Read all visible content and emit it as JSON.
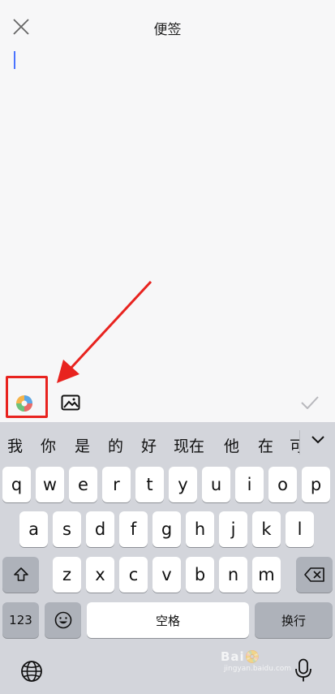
{
  "header": {
    "title": "便签"
  },
  "candidates": [
    "我",
    "你",
    "是",
    "的",
    "好",
    "现在",
    "他",
    "在",
    "可"
  ],
  "keyboard": {
    "row1": [
      "q",
      "w",
      "e",
      "r",
      "t",
      "y",
      "u",
      "i",
      "o",
      "p"
    ],
    "row2": [
      "a",
      "s",
      "d",
      "f",
      "g",
      "h",
      "j",
      "k",
      "l"
    ],
    "row3": [
      "z",
      "x",
      "c",
      "v",
      "b",
      "n",
      "m"
    ],
    "numbers_label": "123",
    "space_label": "空格",
    "return_label": "换行"
  },
  "watermark": {
    "brand": "Bai📀",
    "sub": "jingyan.baidu.com"
  },
  "colors": {
    "accent_cursor": "#4a73ff",
    "highlight": "#e8231f",
    "keyboard_bg": "#d3d5db"
  },
  "icons": [
    "close-icon",
    "palette-icon",
    "image-icon",
    "check-icon",
    "shift-icon",
    "delete-icon",
    "emoji-icon",
    "globe-icon",
    "mic-icon",
    "chevron-down-icon"
  ]
}
